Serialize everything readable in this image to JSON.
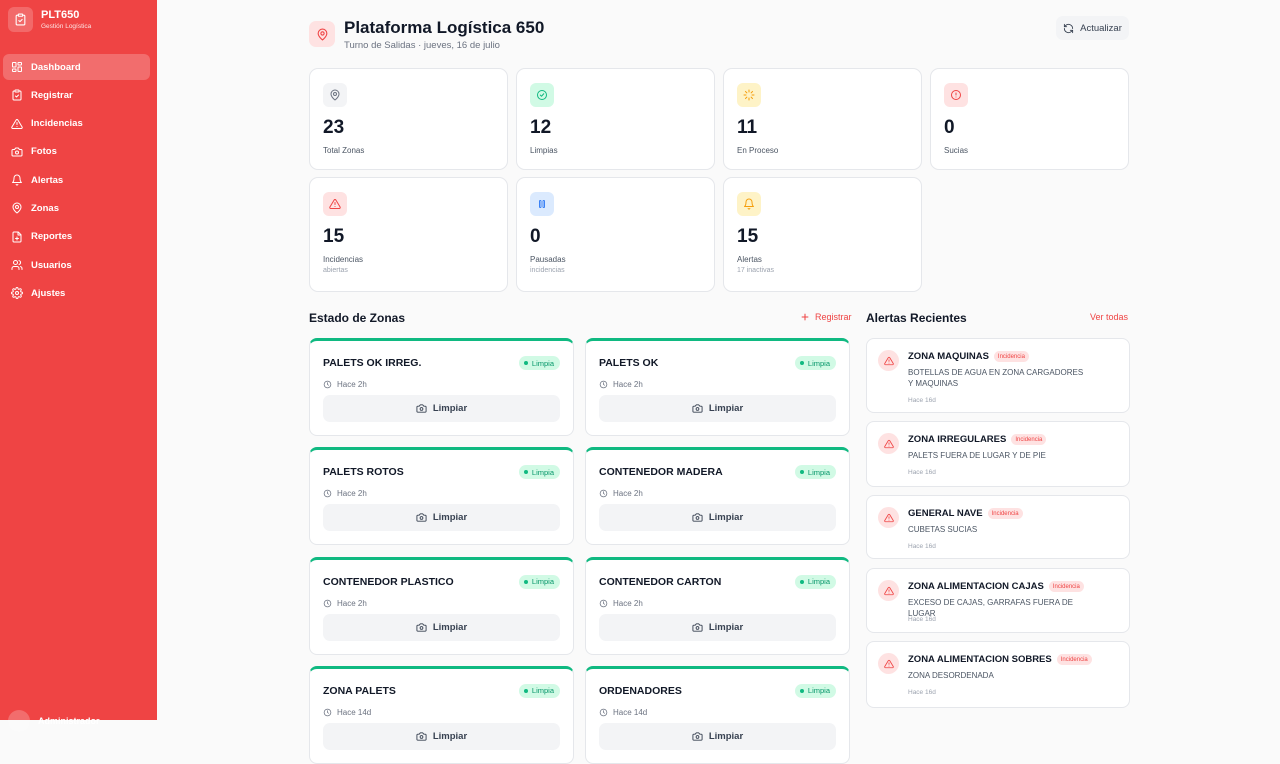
{
  "sidebar": {
    "brand_title": "PLT650",
    "brand_subtitle": "Gestión Logística",
    "items": [
      {
        "label": "Dashboard",
        "icon": "dashboard-icon",
        "active": true
      },
      {
        "label": "Registrar",
        "icon": "clipboard-icon"
      },
      {
        "label": "Incidencias",
        "icon": "warning-icon"
      },
      {
        "label": "Fotos",
        "icon": "camera-icon"
      },
      {
        "label": "Alertas",
        "icon": "bell-icon"
      },
      {
        "label": "Zonas",
        "icon": "map-pin-icon"
      },
      {
        "label": "Reportes",
        "icon": "report-icon"
      },
      {
        "label": "Usuarios",
        "icon": "users-icon"
      },
      {
        "label": "Ajustes",
        "icon": "gear-icon"
      }
    ],
    "user_name": "Administrador"
  },
  "header": {
    "title": "Plataforma Logística 650",
    "subtitle": "Turno de Salidas · jueves, 16 de julio",
    "refresh_label": "Actualizar"
  },
  "stats": [
    {
      "value": "23",
      "label": "Total Zonas",
      "sub": "",
      "icon": "map-pin-icon",
      "color": "#6b7280",
      "bg": "#f3f4f6"
    },
    {
      "value": "12",
      "label": "Limpias",
      "sub": "",
      "icon": "check-circle-icon",
      "color": "#10b981",
      "bg": "#d1fae5"
    },
    {
      "value": "11",
      "label": "En Proceso",
      "sub": "",
      "icon": "loader-icon",
      "color": "#f59e0b",
      "bg": "#fef3c7"
    },
    {
      "value": "0",
      "label": "Sucias",
      "sub": "",
      "icon": "alert-circle-icon",
      "color": "#ef4444",
      "bg": "#fee2e2"
    },
    {
      "value": "15",
      "label": "Incidencias",
      "sub": "abiertas",
      "icon": "warning-icon",
      "color": "#ef4444",
      "bg": "#fee2e2"
    },
    {
      "value": "0",
      "label": "Pausadas",
      "sub": "incidencias",
      "icon": "pause-icon",
      "color": "#3b82f6",
      "bg": "#dbeafe"
    },
    {
      "value": "15",
      "label": "Alertas",
      "sub": "17 inactivas",
      "icon": "bell-icon",
      "color": "#f59e0b",
      "bg": "#fef3c7"
    }
  ],
  "zones_section": {
    "title": "Estado de Zonas",
    "register_label": "Registrar"
  },
  "zones": [
    {
      "name": "PALETS OK IRREG.",
      "status": "Limpia",
      "time": "Hace 2h",
      "button": "Limpiar"
    },
    {
      "name": "PALETS OK",
      "status": "Limpia",
      "time": "Hace 2h",
      "button": "Limpiar"
    },
    {
      "name": "PALETS ROTOS",
      "status": "Limpia",
      "time": "Hace 2h",
      "button": "Limpiar"
    },
    {
      "name": "CONTENEDOR MADERA",
      "status": "Limpia",
      "time": "Hace 2h",
      "button": "Limpiar"
    },
    {
      "name": "CONTENEDOR PLASTICO",
      "status": "Limpia",
      "time": "Hace 2h",
      "button": "Limpiar"
    },
    {
      "name": "CONTENEDOR CARTON",
      "status": "Limpia",
      "time": "Hace 2h",
      "button": "Limpiar"
    },
    {
      "name": "ZONA PALETS",
      "status": "Limpia",
      "time": "Hace 14d",
      "button": "Limpiar"
    },
    {
      "name": "ORDENADORES",
      "status": "Limpia",
      "time": "Hace 14d",
      "button": "Limpiar"
    }
  ],
  "alerts_section": {
    "title": "Alertas Recientes",
    "view_all_label": "Ver todas"
  },
  "alerts": [
    {
      "title": "ZONA MAQUINAS",
      "badge": "Incidencia",
      "desc": "BOTELLAS DE AGUA EN ZONA CARGADORES Y MAQUINAS",
      "time": "Hace 16d"
    },
    {
      "title": "ZONA IRREGULARES",
      "badge": "Incidencia",
      "desc": "PALETS FUERA DE LUGAR Y DE PIE",
      "time": "Hace 16d"
    },
    {
      "title": "GENERAL NAVE",
      "badge": "Incidencia",
      "desc": "CUBETAS SUCIAS",
      "time": "Hace 16d"
    },
    {
      "title": "ZONA ALIMENTACION CAJAS",
      "badge": "Incidencia",
      "desc": "EXCESO DE CAJAS, GARRAFAS FUERA DE LUGAR",
      "time": "Hace 16d"
    },
    {
      "title": "ZONA ALIMENTACION SOBRES",
      "badge": "Incidencia",
      "desc": "ZONA DESORDENADA",
      "time": "Hace 16d"
    }
  ]
}
